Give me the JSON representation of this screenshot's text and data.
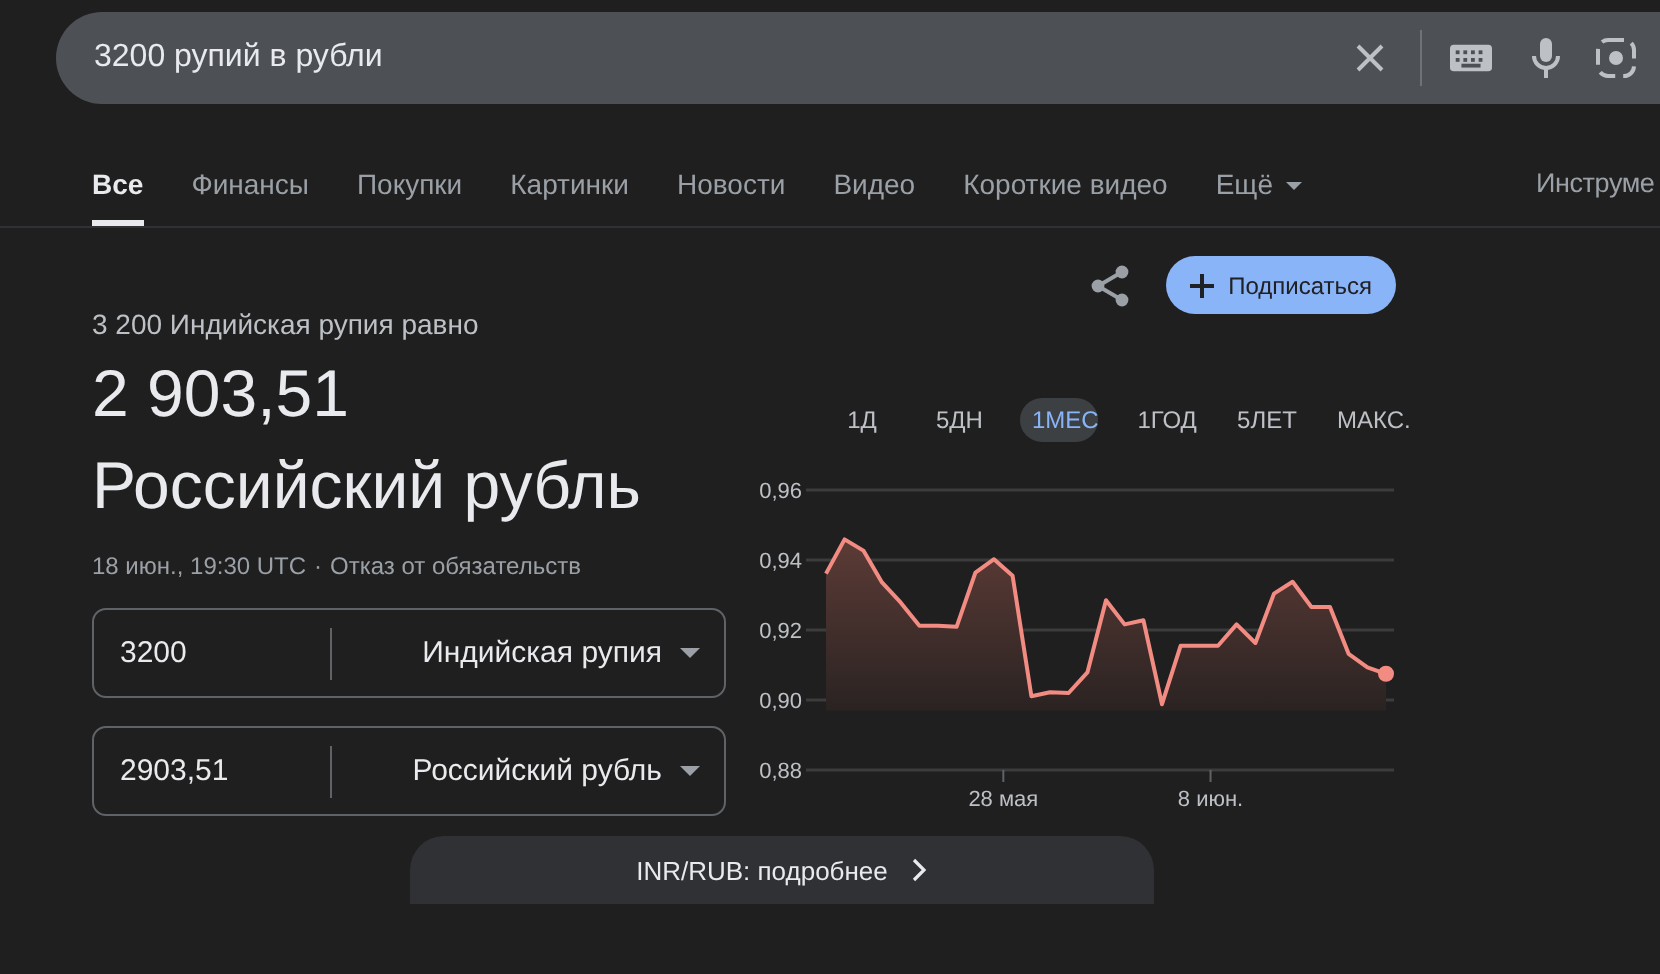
{
  "search": {
    "value": "3200 рупий в рубли"
  },
  "tabs": [
    {
      "label": "Все",
      "selected": true
    },
    {
      "label": "Финансы",
      "selected": false
    },
    {
      "label": "Покупки",
      "selected": false
    },
    {
      "label": "Картинки",
      "selected": false
    },
    {
      "label": "Новости",
      "selected": false
    },
    {
      "label": "Видео",
      "selected": false
    },
    {
      "label": "Короткие видео",
      "selected": false
    },
    {
      "label": "Ещё",
      "selected": false,
      "kind": "dropdown"
    }
  ],
  "tools_label": "Инструме",
  "result": {
    "caption": "3 200 Индийская рупия равно",
    "amount": "2 903,51",
    "currency": "Российский рубль",
    "timestamp": "18 июн., 19:30 UTC",
    "separator": "·",
    "disclaimer": "Отказ от обязательств"
  },
  "converters": [
    {
      "value": "3200",
      "currency": "Индийская рупия"
    },
    {
      "value": "2903,51",
      "currency": "Российский рубль"
    }
  ],
  "subscribe_button": "Подписаться",
  "ranges": [
    {
      "label": "1Д",
      "selected": false
    },
    {
      "label": "5ДН",
      "selected": false
    },
    {
      "label": "1МЕС",
      "selected": true
    },
    {
      "label": "1ГОД",
      "selected": false
    },
    {
      "label": "5ЛЕТ",
      "selected": false
    },
    {
      "label": "МАКС.",
      "selected": false
    }
  ],
  "chart_x_labels": [
    "28 мая",
    "8 июн."
  ],
  "chart_data": {
    "type": "area",
    "series": [
      {
        "color": "#f28b82",
        "values": [
          0.9361,
          0.9459,
          0.9427,
          0.9336,
          0.9279,
          0.9212,
          0.9212,
          0.9209,
          0.9364,
          0.9402,
          0.9355,
          0.9011,
          0.9022,
          0.902,
          0.9079,
          0.9285,
          0.9216,
          0.9228,
          0.8988,
          0.9155,
          0.9155,
          0.9155,
          0.9216,
          0.9163,
          0.9304,
          0.9338,
          0.9266,
          0.9266,
          0.9132,
          0.9093,
          0.9075
        ]
      }
    ],
    "ylim": [
      0.88,
      0.96
    ],
    "yticks": [
      {
        "value": 0.96,
        "label": "0,96"
      },
      {
        "value": 0.94,
        "label": "0,94"
      },
      {
        "value": 0.92,
        "label": "0,92"
      },
      {
        "value": 0.9,
        "label": "0,90"
      },
      {
        "value": 0.88,
        "label": "0,88"
      }
    ],
    "grid": true
  },
  "details_button": "INR/RUB: подробнее"
}
